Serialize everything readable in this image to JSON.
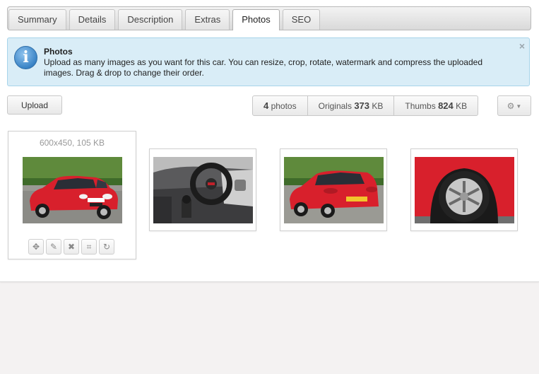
{
  "tabs": [
    "Summary",
    "Details",
    "Description",
    "Extras",
    "Photos",
    "SEO"
  ],
  "active_tab": "Photos",
  "info": {
    "icon": "info-icon",
    "title": "Photos",
    "text": "Upload as many images as you want for this car. You can resize, crop, rotate, watermark and compress the uploaded images. Drag & drop to change their order.",
    "close": "×"
  },
  "toolbar": {
    "upload_label": "Upload",
    "photos_count": "4",
    "photos_label": "photos",
    "originals_label": "Originals",
    "originals_size": "373",
    "originals_unit": "KB",
    "thumbs_label": "Thumbs",
    "thumbs_size": "824",
    "thumbs_unit": "KB",
    "settings_icon": "gear-icon",
    "settings_caret": "▼"
  },
  "photos": [
    {
      "meta": "600x450, 105 KB",
      "subject": "red-car-front",
      "selected": true
    },
    {
      "meta": "",
      "subject": "car-interior",
      "selected": false
    },
    {
      "meta": "",
      "subject": "red-car-rear",
      "selected": false
    },
    {
      "meta": "",
      "subject": "car-wheel",
      "selected": false
    }
  ],
  "photo_actions": [
    "move-icon",
    "edit-icon",
    "delete-icon",
    "crop-icon",
    "rotate-icon"
  ],
  "colors": {
    "info_bg": "#d9edf7",
    "info_border": "#a7d4ea",
    "car_red": "#d8202c"
  }
}
